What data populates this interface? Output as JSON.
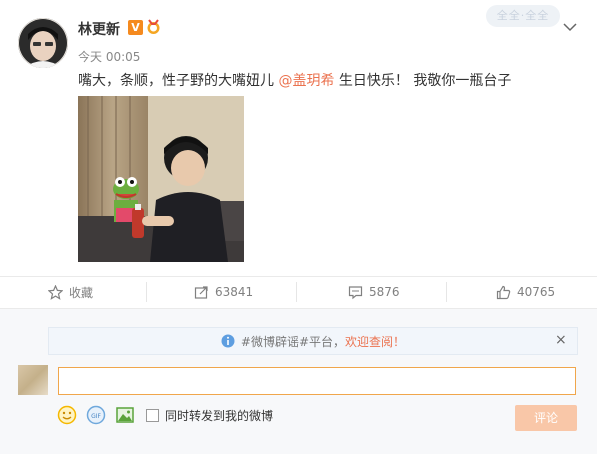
{
  "post": {
    "username": "林更新",
    "badge_v": "V",
    "time": "今天 00:05",
    "content_before": "嘴大，条顺，性子野的大嘴妞儿 ",
    "mention": "@盖玥希",
    "content_after": " 生日快乐！ 我敬你一瓶台子",
    "watermark": "全全·全全"
  },
  "actions": {
    "favorite_label": "收藏",
    "repost_count": "63841",
    "comment_count": "5876",
    "like_count": "40765"
  },
  "comment": {
    "notice_prefix": "#微博辟谣#平台，",
    "notice_link": "欢迎查阅！",
    "notice_close": "×",
    "input_value": "",
    "repost_checkbox_label": "同时转发到我的微博",
    "submit_label": "评论"
  },
  "colors": {
    "accent": "#eb7350",
    "input_border": "#f0a64b",
    "submit_bg": "#f9c7a8"
  }
}
